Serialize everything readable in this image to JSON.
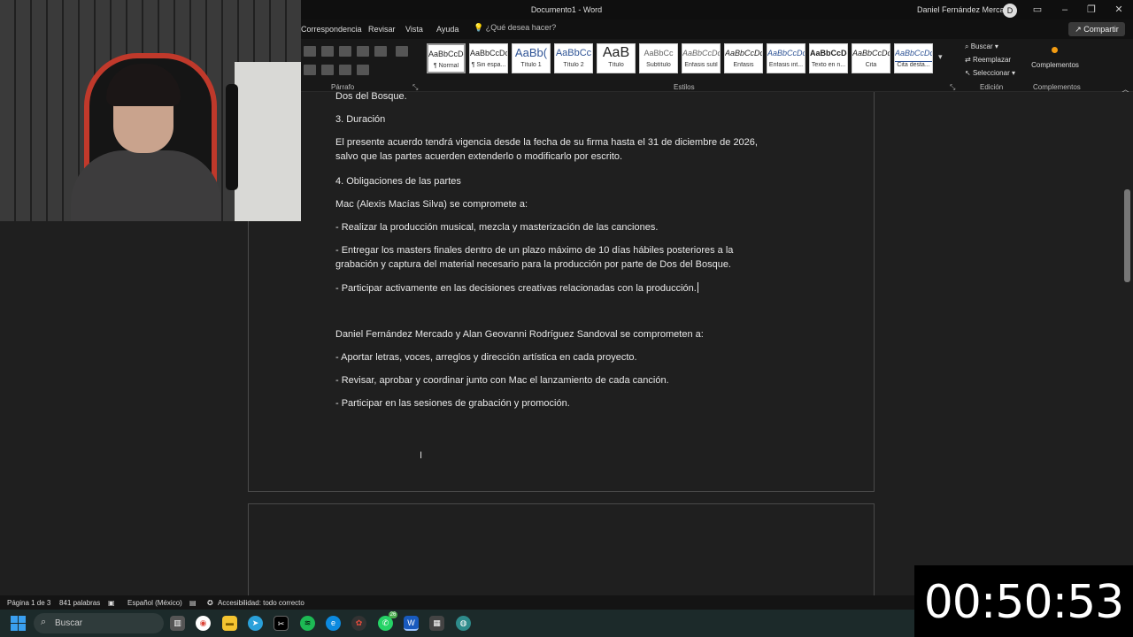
{
  "window": {
    "title": "Documento1  -  Word",
    "user_name": "Daniel Fernández Mercado",
    "avatar_initial": "D",
    "buttons": [
      "ribbon-display-icon",
      "minimize-icon",
      "restore-icon",
      "close-icon"
    ]
  },
  "tabs": {
    "items": [
      "Correspondencia",
      "Revisar",
      "Vista",
      "Ayuda"
    ],
    "tell_me": "¿Qué desea hacer?",
    "share": "Compartir"
  },
  "ribbon": {
    "paragraph_group": "Párrafo",
    "styles_group": "Estilos",
    "styles": [
      {
        "sample": "AaBbCcDc",
        "name": "¶ Normal"
      },
      {
        "sample": "AaBbCcDc",
        "name": "¶ Sin espa..."
      },
      {
        "sample": "AaBb(",
        "name": "Título 1"
      },
      {
        "sample": "AaBbCc",
        "name": "Título 2"
      },
      {
        "sample": "AaB",
        "name": "Título"
      },
      {
        "sample": "AaBbCc",
        "name": "Subtítulo"
      },
      {
        "sample": "AaBbCcDc",
        "name": "Énfasis sutil"
      },
      {
        "sample": "AaBbCcDc",
        "name": "Énfasis"
      },
      {
        "sample": "AaBbCcDc",
        "name": "Énfasis int..."
      },
      {
        "sample": "AaBbCcDc",
        "name": "Texto en n..."
      },
      {
        "sample": "AaBbCcDc",
        "name": "Cita"
      },
      {
        "sample": "AaBbCcDc",
        "name": "Cita desta..."
      }
    ],
    "editing": {
      "find": "Buscar",
      "replace": "Reemplazar",
      "select": "Seleccionar",
      "group": "Edición"
    },
    "addins": {
      "button": "Complementos",
      "group": "Complementos"
    }
  },
  "document": {
    "paragraphs": [
      "Dos del Bosque.",
      "3. Duración",
      "El presente acuerdo tendrá vigencia desde la fecha de su firma hasta el 31 de diciembre de 2026, salvo que las partes acuerden extenderlo o modificarlo por escrito.",
      "4. Obligaciones de las partes",
      "Mac (Alexis Macías Silva) se compromete a:",
      "- Realizar la producción musical, mezcla y masterización de las canciones.",
      "- Entregar los masters finales dentro de un plazo máximo de 10 días hábiles posteriores a la grabación y captura del material necesario para la producción por parte de Dos del Bosque.",
      "- Participar activamente en las decisiones creativas relacionadas con la producción.",
      "Daniel Fernández Mercado y Alan Geovanni Rodríguez Sandoval se comprometen a:",
      "- Aportar letras, voces, arreglos y dirección artística en cada proyecto.",
      "- Revisar, aprobar y coordinar junto con Mac el lanzamiento de cada canción.",
      "- Participar en las sesiones de grabación y promoción."
    ]
  },
  "status": {
    "page": "Página 1 de 3",
    "words": "841 palabras",
    "language": "Español (México)",
    "accessibility": "Accesibilidad: todo correcto"
  },
  "taskbar": {
    "search": "Buscar",
    "whatsapp_badge": "26",
    "icons": [
      "windows-start-icon",
      "task-view-icon",
      "chrome-icon",
      "file-explorer-icon",
      "telegram-icon",
      "capcut-icon",
      "spotify-icon",
      "edge-icon",
      "davinci-icon",
      "whatsapp-icon",
      "word-icon",
      "calculator-icon",
      "globe-icon"
    ]
  },
  "overlay": {
    "timer": "00:50:53"
  },
  "colors": {
    "accent": "#c0392b",
    "word_blue": "#185abd",
    "spotify": "#1db954",
    "whatsapp": "#25d366"
  }
}
